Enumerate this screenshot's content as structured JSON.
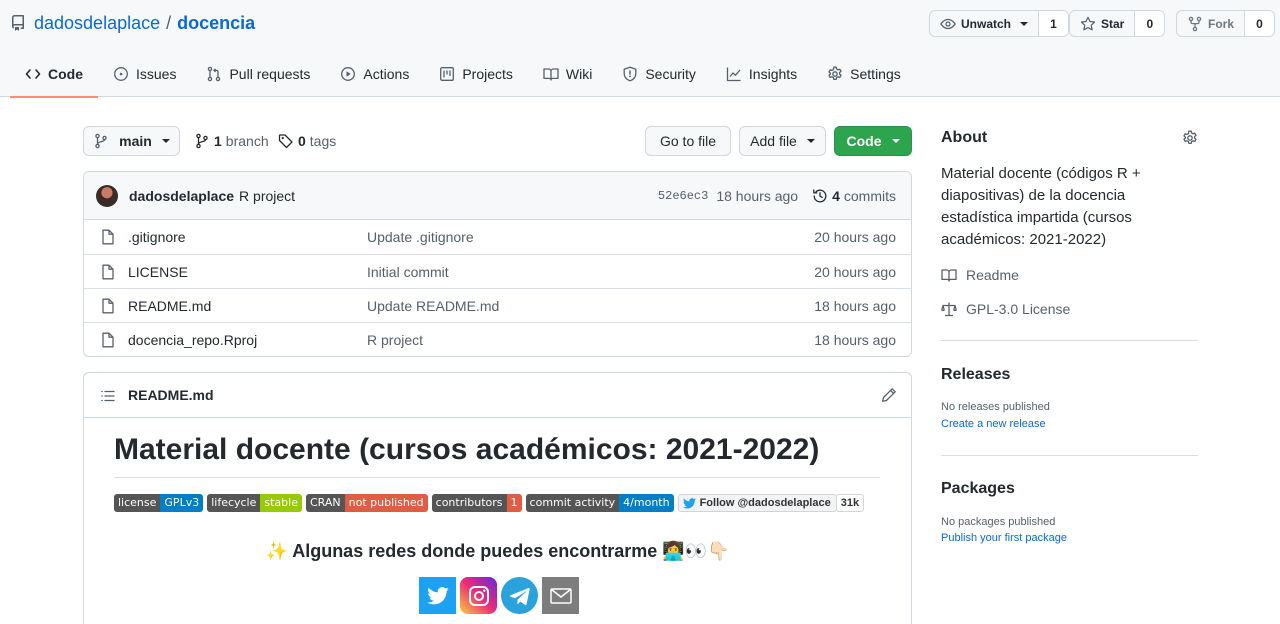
{
  "repo": {
    "owner": "dadosdelaplace",
    "separator": "/",
    "name": "docencia"
  },
  "header_buttons": {
    "watch": {
      "label": "Unwatch",
      "count": "1"
    },
    "star": {
      "label": "Star",
      "count": "0"
    },
    "fork": {
      "label": "Fork",
      "count": "0"
    }
  },
  "tabs": [
    {
      "label": "Code",
      "icon": "code-icon"
    },
    {
      "label": "Issues",
      "icon": "issue-icon"
    },
    {
      "label": "Pull requests",
      "icon": "pull-request-icon"
    },
    {
      "label": "Actions",
      "icon": "play-icon"
    },
    {
      "label": "Projects",
      "icon": "project-icon"
    },
    {
      "label": "Wiki",
      "icon": "book-icon"
    },
    {
      "label": "Security",
      "icon": "shield-icon"
    },
    {
      "label": "Insights",
      "icon": "graph-icon"
    },
    {
      "label": "Settings",
      "icon": "gear-icon"
    }
  ],
  "filenav": {
    "branch_button": "main",
    "branches_count": "1",
    "branches_label": "branch",
    "tags_count": "0",
    "tags_label": "tags",
    "go_to_file": "Go to file",
    "add_file": "Add file",
    "code": "Code"
  },
  "latest_commit": {
    "author": "dadosdelaplace",
    "message": "R project",
    "sha": "52e6ec3",
    "age": "18 hours ago",
    "commits_count": "4",
    "commits_label": "commits"
  },
  "files": [
    {
      "name": ".gitignore",
      "message": "Update .gitignore",
      "age": "20 hours ago"
    },
    {
      "name": "LICENSE",
      "message": "Initial commit",
      "age": "20 hours ago"
    },
    {
      "name": "README.md",
      "message": "Update README.md",
      "age": "18 hours ago"
    },
    {
      "name": "docencia_repo.Rproj",
      "message": "R project",
      "age": "18 hours ago"
    }
  ],
  "readme": {
    "filename": "README.md",
    "title": "Material docente (cursos académicos: 2021-2022)",
    "badges": [
      {
        "left": "license",
        "right": "GPLv3",
        "color": "#007ec6"
      },
      {
        "left": "lifecycle",
        "right": "stable",
        "color": "#97ca00"
      },
      {
        "left": "CRAN",
        "right": "not published",
        "color": "#e05d44"
      },
      {
        "left": "contributors",
        "right": "1",
        "color": "#e05d44"
      },
      {
        "left": "commit activity",
        "right": "4/month",
        "color": "#007ec6"
      }
    ],
    "twitter_follow": "Follow @dadosdelaplace",
    "twitter_count": "31k",
    "redes_text": "✨ Algunas redes donde puedes encontrarme 👩‍💻👀👇🏻",
    "socials": [
      "twitter-icon",
      "instagram-icon",
      "telegram-icon",
      "mail-icon"
    ]
  },
  "about": {
    "heading": "About",
    "description": "Material docente (códigos R + diapositivas) de la docencia estadística impartida (cursos académicos: 2021-2022)",
    "readme_label": "Readme",
    "license_label": "GPL-3.0 License"
  },
  "releases": {
    "heading": "Releases",
    "empty": "No releases published",
    "link": "Create a new release"
  },
  "packages": {
    "heading": "Packages",
    "empty": "No packages published",
    "link": "Publish your first package"
  },
  "colors": {
    "accent": "#0969da",
    "green": "#2da44e",
    "tab_underline": "#fd8c73"
  }
}
